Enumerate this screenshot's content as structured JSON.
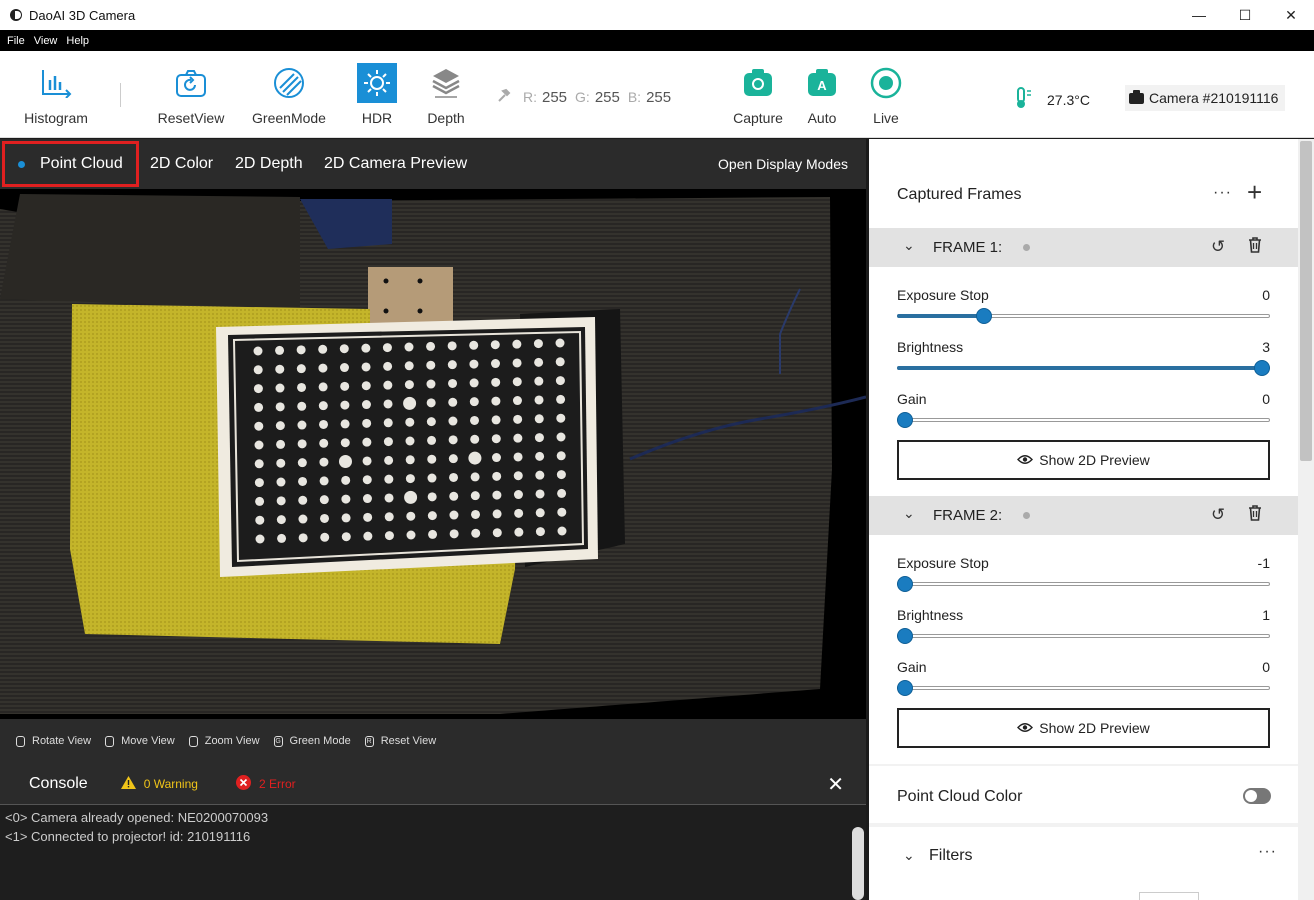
{
  "window": {
    "title": "DaoAI 3D Camera"
  },
  "menu": [
    "File",
    "View",
    "Help"
  ],
  "toolbar": {
    "histogram": "Histogram",
    "reset_view": "ResetView",
    "green_mode": "GreenMode",
    "hdr": "HDR",
    "depth": "Depth",
    "rgb": {
      "r_label": "R:",
      "r": "255",
      "g_label": "G:",
      "g": "255",
      "b_label": "B:",
      "b": "255"
    },
    "capture": "Capture",
    "auto": "Auto",
    "live": "Live",
    "temperature": "27.3°C",
    "camera": "Camera #210191116",
    "accent": "#1ab39a"
  },
  "viewer_tabs": {
    "items": [
      "Point Cloud",
      "2D Color",
      "2D Depth",
      "2D Camera Preview"
    ],
    "open_modes": "Open Display Modes"
  },
  "hints": [
    {
      "key": "",
      "label": "Rotate View"
    },
    {
      "key": "",
      "label": "Move View"
    },
    {
      "key": "",
      "label": "Zoom View"
    },
    {
      "key": "G",
      "label": "Green Mode"
    },
    {
      "key": "R",
      "label": "Reset View"
    }
  ],
  "console": {
    "title": "Console",
    "warning": "0 Warning",
    "error": "2 Error",
    "lines": [
      "<0> Camera already opened: NE0200070093",
      "<1> Connected to projector! id: 210191116"
    ]
  },
  "panel": {
    "title": "Captured Frames",
    "frames": [
      {
        "name": "FRAME 1:",
        "sliders": [
          {
            "label": "Exposure Stop",
            "value": "0",
            "fraction": 0.22
          },
          {
            "label": "Brightness",
            "value": "3",
            "fraction": 1.0
          },
          {
            "label": "Gain",
            "value": "0",
            "fraction": 0.0
          }
        ],
        "preview": "Show 2D Preview"
      },
      {
        "name": "FRAME 2:",
        "sliders": [
          {
            "label": "Exposure Stop",
            "value": "-1",
            "fraction": 0.0
          },
          {
            "label": "Brightness",
            "value": "1",
            "fraction": 0.0
          },
          {
            "label": "Gain",
            "value": "0",
            "fraction": 0.0
          }
        ],
        "preview": "Show 2D Preview"
      }
    ],
    "point_cloud_color": "Point Cloud Color",
    "filters": "Filters"
  }
}
